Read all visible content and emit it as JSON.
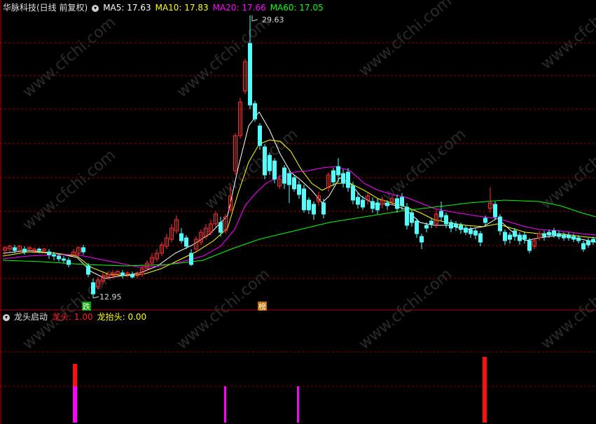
{
  "main_chart": {
    "title": "华脉科技(日线 前复权)",
    "ma": [
      {
        "label": "MA5: 17.63",
        "color": "#ffffff"
      },
      {
        "label": "MA10: 17.83",
        "color": "#ffff00"
      },
      {
        "label": "MA20: 17.66",
        "color": "#ff00ff"
      },
      {
        "label": "MA60: 17.05",
        "color": "#00ff00"
      }
    ],
    "high_label": "29.63",
    "low_label": "12.95",
    "markers": [
      {
        "text": "跌",
        "bg": "#00a000",
        "fg": "#ffffff"
      },
      {
        "text": "榜",
        "bg": "#c07000",
        "fg": "#ffffff"
      }
    ],
    "watermark": "www.cfchi.com"
  },
  "indicator": {
    "name": "龙头启动",
    "items": [
      {
        "label": "龙头: 1.00",
        "color": "#ff2020"
      },
      {
        "label": "龙抬头: 0.00",
        "color": "#ffff00"
      }
    ]
  },
  "colors": {
    "up": "#ff3030",
    "down": "#54ffff",
    "grid": "#8b0000",
    "ma5": "#ffffff",
    "ma10": "#ffff00",
    "ma20": "#ff00ff",
    "ma60": "#00ff00",
    "bar_red": "#ff1010",
    "bar_magenta": "#ff00ff"
  }
}
